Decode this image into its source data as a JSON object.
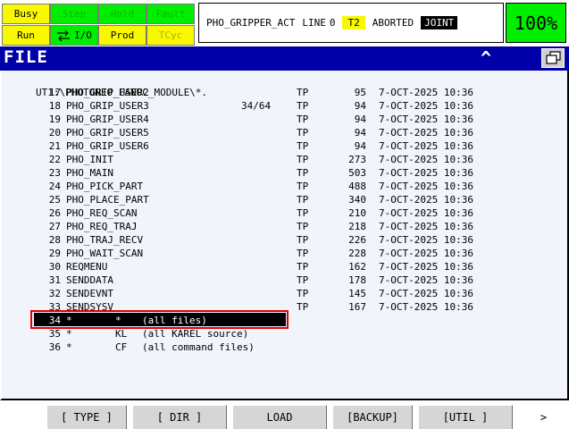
{
  "status_indicators": {
    "busy": "Busy",
    "step": "Step",
    "hold": "Hold",
    "fault": "Fault",
    "run": "Run",
    "io": "I/O",
    "prod": "Prod",
    "tcyc": "TCyc"
  },
  "status_line": {
    "program": "PHO_GRIPPER_ACT",
    "line_label": "LINE",
    "line_number": "0",
    "mode": "T2",
    "state": "ABORTED",
    "coord": "JOINT"
  },
  "speed_override": "100%",
  "screen_title": "FILE",
  "file_list": {
    "path": "UT1:\\PHOTONEO_FANUC_MODULE\\*.",
    "counter": "34/64",
    "files": [
      {
        "num": "17",
        "name": "PHO_GRIP_USER2",
        "type": "TP",
        "size": "95",
        "date": "7-OCT-2025 10:36"
      },
      {
        "num": "18",
        "name": "PHO_GRIP_USER3",
        "type": "TP",
        "size": "94",
        "date": "7-OCT-2025 10:36"
      },
      {
        "num": "19",
        "name": "PHO_GRIP_USER4",
        "type": "TP",
        "size": "94",
        "date": "7-OCT-2025 10:36"
      },
      {
        "num": "20",
        "name": "PHO_GRIP_USER5",
        "type": "TP",
        "size": "94",
        "date": "7-OCT-2025 10:36"
      },
      {
        "num": "21",
        "name": "PHO_GRIP_USER6",
        "type": "TP",
        "size": "94",
        "date": "7-OCT-2025 10:36"
      },
      {
        "num": "22",
        "name": "PHO_INIT",
        "type": "TP",
        "size": "273",
        "date": "7-OCT-2025 10:36"
      },
      {
        "num": "23",
        "name": "PHO_MAIN",
        "type": "TP",
        "size": "503",
        "date": "7-OCT-2025 10:36"
      },
      {
        "num": "24",
        "name": "PHO_PICK_PART",
        "type": "TP",
        "size": "488",
        "date": "7-OCT-2025 10:36"
      },
      {
        "num": "25",
        "name": "PHO_PLACE_PART",
        "type": "TP",
        "size": "340",
        "date": "7-OCT-2025 10:36"
      },
      {
        "num": "26",
        "name": "PHO_REQ_SCAN",
        "type": "TP",
        "size": "210",
        "date": "7-OCT-2025 10:36"
      },
      {
        "num": "27",
        "name": "PHO_REQ_TRAJ",
        "type": "TP",
        "size": "218",
        "date": "7-OCT-2025 10:36"
      },
      {
        "num": "28",
        "name": "PHO_TRAJ_RECV",
        "type": "TP",
        "size": "226",
        "date": "7-OCT-2025 10:36"
      },
      {
        "num": "29",
        "name": "PHO_WAIT_SCAN",
        "type": "TP",
        "size": "228",
        "date": "7-OCT-2025 10:36"
      },
      {
        "num": "30",
        "name": "REQMENU",
        "type": "TP",
        "size": "162",
        "date": "7-OCT-2025 10:36"
      },
      {
        "num": "31",
        "name": "SENDDATA",
        "type": "TP",
        "size": "178",
        "date": "7-OCT-2025 10:36"
      },
      {
        "num": "32",
        "name": "SENDEVNT",
        "type": "TP",
        "size": "145",
        "date": "7-OCT-2025 10:36"
      },
      {
        "num": "33",
        "name": "SENDSYSV",
        "type": "TP",
        "size": "167",
        "date": "7-OCT-2025 10:36"
      }
    ],
    "filters": [
      {
        "num": "34",
        "name": "*",
        "ext": "*",
        "desc": "(all files)",
        "selected": true
      },
      {
        "num": "35",
        "name": "*",
        "ext": "KL",
        "desc": "(all KAREL source)",
        "selected": false
      },
      {
        "num": "36",
        "name": "*",
        "ext": "CF",
        "desc": "(all command files)",
        "selected": false
      }
    ]
  },
  "function_keys": [
    "[ TYPE ]",
    "[ DIR ]",
    "LOAD",
    "[BACKUP]",
    "[UTIL ]",
    ">"
  ],
  "colors": {
    "title_bar": "#0000a8",
    "indicator_yellow": "#f8f800",
    "indicator_green": "#00ee00",
    "selection_outline": "#e00000"
  }
}
